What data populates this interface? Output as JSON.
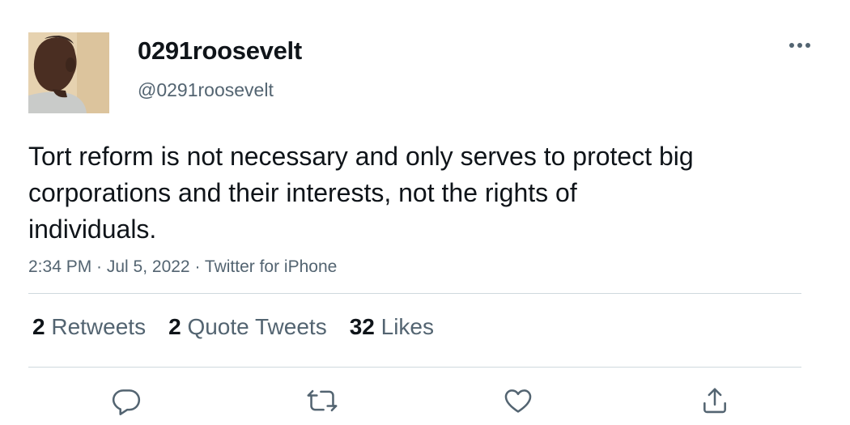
{
  "user": {
    "display_name": "0291roosevelt",
    "handle": "@0291roosevelt"
  },
  "tweet": {
    "text": "Tort reform is not necessary and only serves to protect big corporations and their interests, not the rights of individuals.",
    "meta": "2:34 PM · Jul 5, 2022 · Twitter for iPhone"
  },
  "stats": {
    "retweets_count": "2",
    "retweets_label": "Retweets",
    "quotes_count": "2",
    "quotes_label": "Quote Tweets",
    "likes_count": "32",
    "likes_label": "Likes"
  },
  "icons": {
    "more": "more-dots-icon",
    "reply": "reply-icon",
    "retweet": "retweet-icon",
    "like": "like-icon",
    "share": "share-icon"
  },
  "colors": {
    "text_primary": "#0f1419",
    "text_secondary": "#536471",
    "divider": "#cfd9de",
    "background": "#ffffff"
  }
}
